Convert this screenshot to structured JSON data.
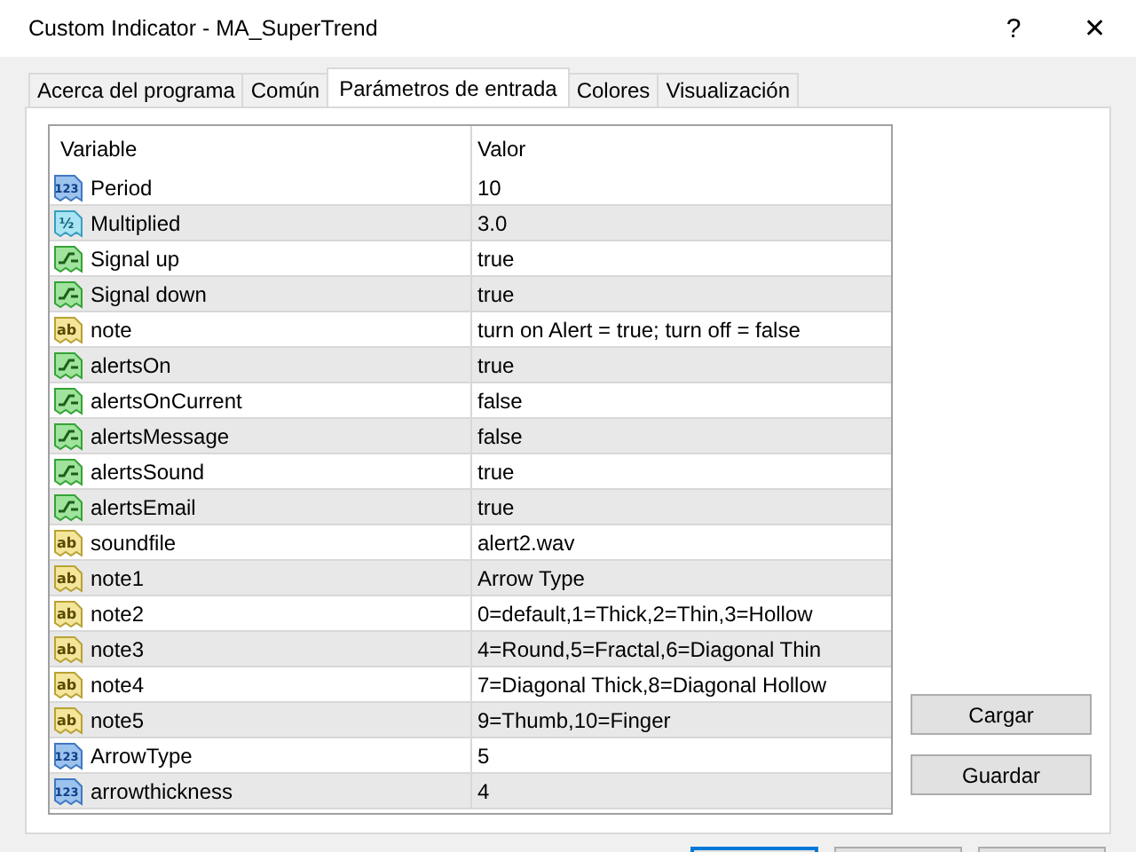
{
  "window": {
    "title": "Custom Indicator - MA_SuperTrend",
    "help": "?",
    "close": "✕"
  },
  "tabs": [
    {
      "label": "Acerca del programa",
      "selected": false
    },
    {
      "label": "Común",
      "selected": false
    },
    {
      "label": "Parámetros de entrada",
      "selected": true
    },
    {
      "label": "Colores",
      "selected": false
    },
    {
      "label": "Visualización",
      "selected": false
    }
  ],
  "table": {
    "columns": [
      "Variable",
      "Valor"
    ],
    "rows": [
      {
        "kind": "int",
        "icon_label": "123",
        "variable": "Period",
        "value": "10"
      },
      {
        "kind": "double",
        "icon_label": "½",
        "variable": "Multiplied",
        "value": "3.0"
      },
      {
        "kind": "bool",
        "variable": "Signal up",
        "value": "true"
      },
      {
        "kind": "bool",
        "variable": "Signal down",
        "value": "true"
      },
      {
        "kind": "string",
        "icon_label": "ab",
        "variable": "note",
        "value": "turn on Alert = true; turn off = false"
      },
      {
        "kind": "bool",
        "variable": "alertsOn",
        "value": "true"
      },
      {
        "kind": "bool",
        "variable": "alertsOnCurrent",
        "value": "false"
      },
      {
        "kind": "bool",
        "variable": "alertsMessage",
        "value": "false"
      },
      {
        "kind": "bool",
        "variable": "alertsSound",
        "value": "true"
      },
      {
        "kind": "bool",
        "variable": "alertsEmail",
        "value": "true"
      },
      {
        "kind": "string",
        "icon_label": "ab",
        "variable": "soundfile",
        "value": "alert2.wav"
      },
      {
        "kind": "string",
        "icon_label": "ab",
        "variable": "note1",
        "value": "Arrow Type"
      },
      {
        "kind": "string",
        "icon_label": "ab",
        "variable": "note2",
        "value": "0=default,1=Thick,2=Thin,3=Hollow"
      },
      {
        "kind": "string",
        "icon_label": "ab",
        "variable": "note3",
        "value": "4=Round,5=Fractal,6=Diagonal Thin"
      },
      {
        "kind": "string",
        "icon_label": "ab",
        "variable": "note4",
        "value": "7=Diagonal Thick,8=Diagonal Hollow"
      },
      {
        "kind": "string",
        "icon_label": "ab",
        "variable": "note5",
        "value": "9=Thumb,10=Finger"
      },
      {
        "kind": "int",
        "icon_label": "123",
        "variable": "ArrowType",
        "value": "5"
      },
      {
        "kind": "int",
        "icon_label": "123",
        "variable": "arrowthickness",
        "value": "4"
      }
    ]
  },
  "side_buttons": [
    "Cargar",
    "Guardar"
  ],
  "footer_buttons": [
    {
      "kind": "default"
    },
    {
      "kind": "normal"
    },
    {
      "kind": "normal"
    }
  ]
}
